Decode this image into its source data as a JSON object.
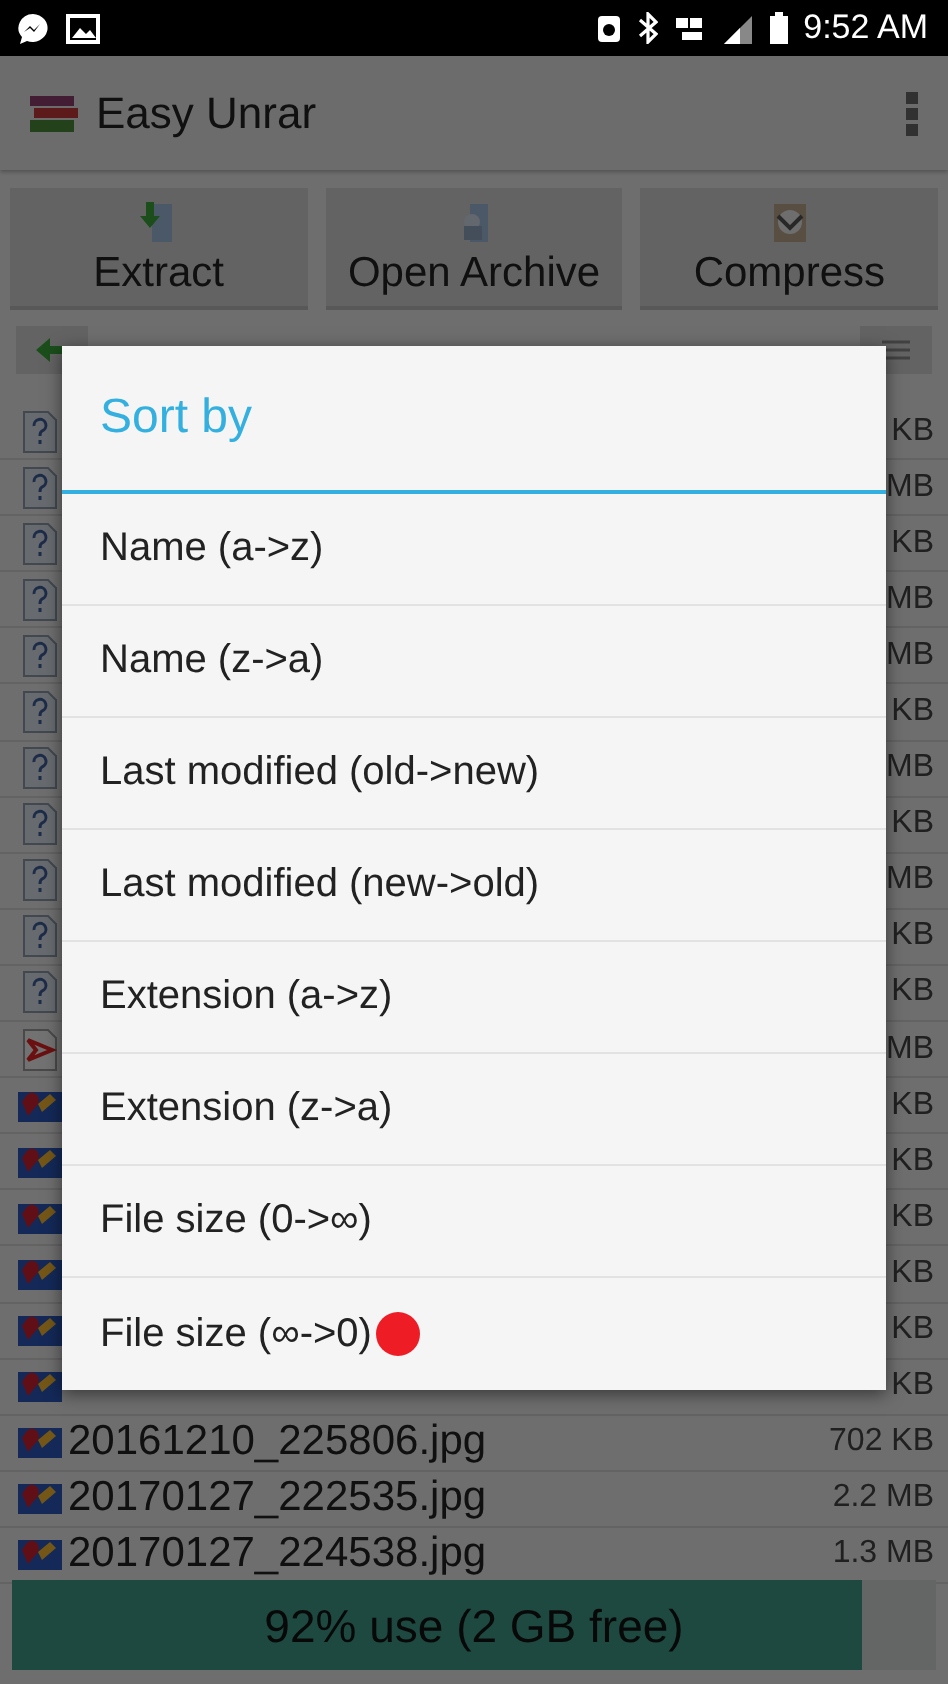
{
  "status_bar": {
    "time": "9:52 AM"
  },
  "app_bar": {
    "title": "Easy Unrar"
  },
  "actions": [
    {
      "label": "Extract",
      "kind": "extract"
    },
    {
      "label": "Open Archive",
      "kind": "open"
    },
    {
      "label": "Compress",
      "kind": "compress"
    }
  ],
  "files": [
    {
      "kind": "unknown",
      "size": "KB"
    },
    {
      "kind": "unknown",
      "size": "MB"
    },
    {
      "kind": "unknown",
      "size": "KB"
    },
    {
      "kind": "unknown",
      "size": "MB"
    },
    {
      "kind": "unknown",
      "size": "MB"
    },
    {
      "kind": "unknown",
      "size": "KB"
    },
    {
      "kind": "unknown",
      "size": "MB"
    },
    {
      "kind": "unknown",
      "size": "KB"
    },
    {
      "kind": "unknown",
      "size": "MB"
    },
    {
      "kind": "unknown",
      "size": "KB"
    },
    {
      "kind": "unknown",
      "size": "KB"
    },
    {
      "kind": "pdf",
      "size": "MB"
    },
    {
      "kind": "image",
      "size": "KB"
    },
    {
      "kind": "image",
      "size": "KB"
    },
    {
      "kind": "image",
      "size": "KB"
    },
    {
      "kind": "image",
      "size": "KB"
    },
    {
      "kind": "image",
      "size": "KB"
    },
    {
      "kind": "image",
      "size": "KB"
    },
    {
      "kind": "image",
      "name": "20161210_225806.jpg",
      "size": "702 KB"
    },
    {
      "kind": "image",
      "name": "20170127_222535.jpg",
      "size": "2.2 MB"
    },
    {
      "kind": "image",
      "name": "20170127_224538.jpg",
      "size": "1.3 MB"
    }
  ],
  "storage": {
    "label": "92% use (2 GB free)",
    "level": 0.92
  },
  "dialog": {
    "title": "Sort by",
    "options": [
      {
        "label": "Name (a->z)",
        "selected": false
      },
      {
        "label": "Name (z->a)",
        "selected": false
      },
      {
        "label": "Last modified (old->new)",
        "selected": false
      },
      {
        "label": "Last modified (new->old)",
        "selected": false
      },
      {
        "label": "Extension (a->z)",
        "selected": false
      },
      {
        "label": "Extension (z->a)",
        "selected": false
      },
      {
        "label": "File size (0->∞)",
        "selected": false
      },
      {
        "label": "File size (∞->0)",
        "selected": true
      }
    ]
  }
}
